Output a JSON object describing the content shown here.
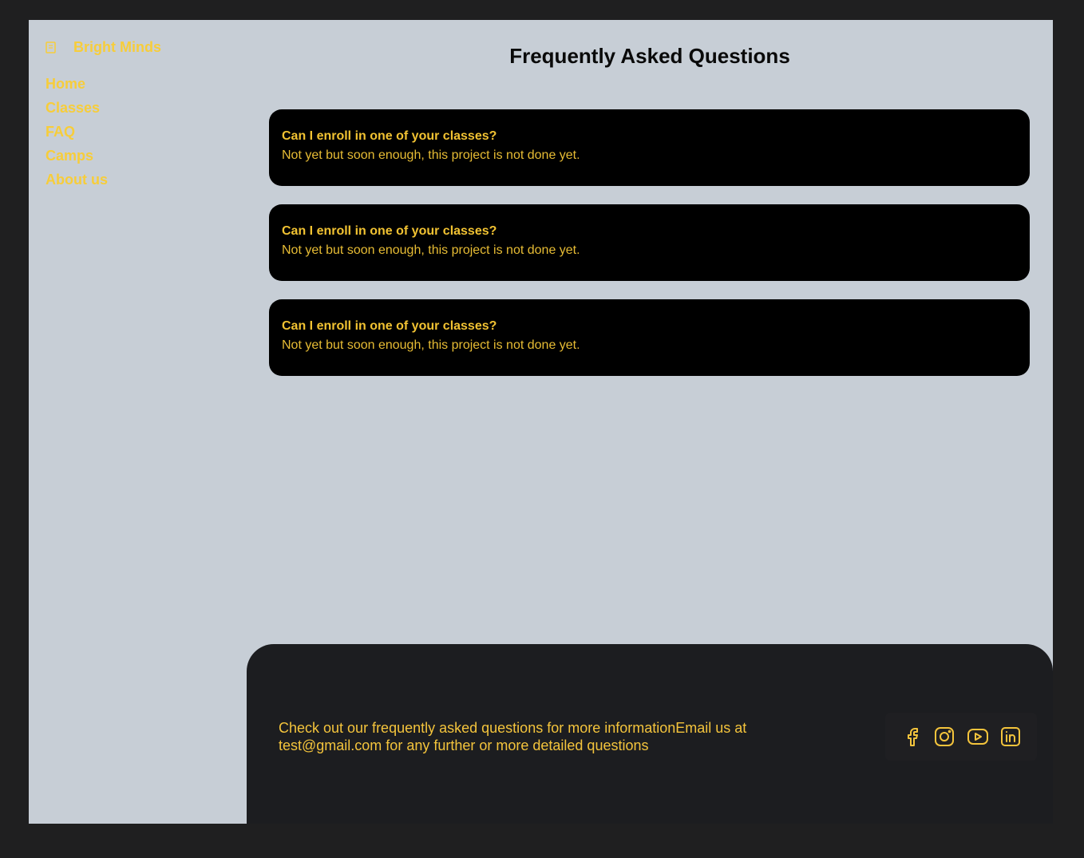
{
  "brand": {
    "name": "Bright Minds",
    "icon": "book-icon"
  },
  "nav": [
    "Home",
    "Classes",
    "FAQ",
    "Camps",
    "About us"
  ],
  "page_title": "Frequently Asked Questions",
  "faq": [
    {
      "question": "Can I enroll in one of your classes?",
      "answer": "Not yet but soon enough, this project is not done yet."
    },
    {
      "question": "Can I enroll in one of your classes?",
      "answer": "Not yet but soon enough, this project is not done yet."
    },
    {
      "question": "Can I enroll in one of your classes?",
      "answer": "Not yet but soon enough, this project is not done yet."
    }
  ],
  "footer": {
    "text": "Check out our frequently asked questions for more informationEmail us at test@gmail.com for any further or more detailed questions",
    "socials": [
      "facebook-icon",
      "instagram-icon",
      "youtube-icon",
      "linkedin-icon"
    ]
  },
  "colors": {
    "accent": "#f7cd3a",
    "background": "#c7ced6",
    "card": "#000000",
    "footer": "#1c1d20"
  }
}
